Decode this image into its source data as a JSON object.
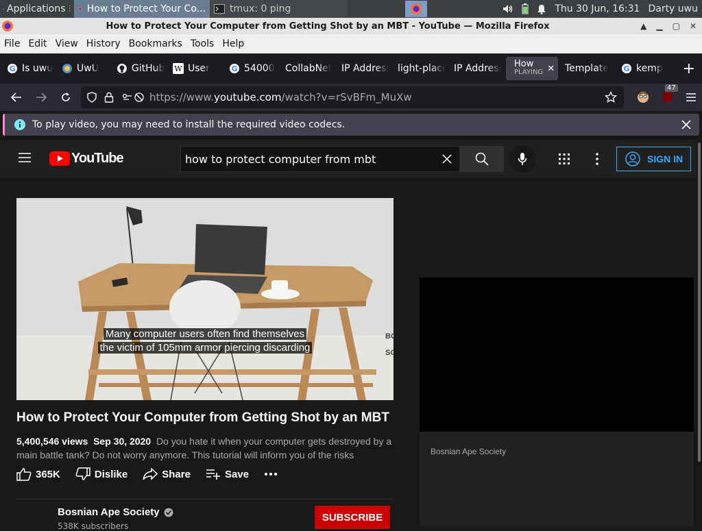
{
  "taskbar": {
    "applications": "Applications",
    "task1": "How to Protect Your Co...",
    "task2": "tmux: 0 ping",
    "datetime": "Thu 30 Jun, 16:31",
    "user": "Darty uwu"
  },
  "window": {
    "title": "How to Protect Your Computer from Getting Shot by an MBT - YouTube — Mozilla Firefox"
  },
  "menu": {
    "file": "File",
    "edit": "Edit",
    "view": "View",
    "history": "History",
    "bookmarks": "Bookmarks",
    "tools": "Tools",
    "help": "Help"
  },
  "tabs": [
    {
      "label": "Is uwu"
    },
    {
      "label": "UwU"
    },
    {
      "label": "GitHub"
    },
    {
      "label": "User"
    },
    {
      "label": "54000"
    },
    {
      "label": "CollabNet"
    },
    {
      "label": "IP Address"
    },
    {
      "label": "light-place"
    },
    {
      "label": "IP Address"
    },
    {
      "label": "How",
      "sub": "PLAYING"
    },
    {
      "label": "Template"
    },
    {
      "label": "kemp"
    }
  ],
  "nav": {
    "url_prefix": "https://www.",
    "url_host": "youtube.com",
    "url_path": "/watch?v=rSvBFm_MuXw",
    "ext_badge": "47"
  },
  "notice": {
    "text": "To play video, you may need to install the required video codecs."
  },
  "yt": {
    "logo_text": "YouTube",
    "search_value": "how to protect computer from mbt",
    "sign_in": "SIGN IN",
    "caption_line1": "Many computer users often find themselves",
    "caption_line2": "the victim of 105mm armor piercing discarding",
    "video_side_text1": "BO",
    "video_side_text2": "SO",
    "video_title": "How to Protect Your Computer from Getting Shot by an MBT",
    "views": "5,400,546 views",
    "date": "Sep 30, 2020",
    "description": "Do you hate it when your computer gets destroyed by a main battle tank? Do not worry anymore. This tutorial will inform you of the risks",
    "likes": "365K",
    "dislike": "Dislike",
    "share": "Share",
    "save": "Save",
    "channel_name": "Bosnian Ape Society",
    "subscribers": "538K subscribers",
    "subscribe": "SUBSCRIBE",
    "side_owner": "Bosnian Ape Society"
  },
  "colors": {
    "yt_red": "#ff0000",
    "subscribe_red": "#cc0000",
    "link_blue": "#3ea6ff",
    "notice_accent": "#ff84d8"
  }
}
